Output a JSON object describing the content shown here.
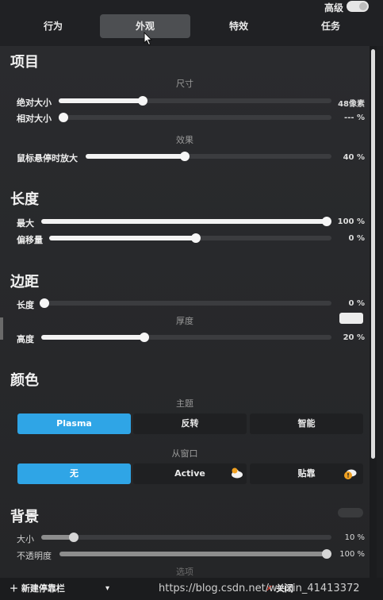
{
  "header": {
    "tabs": [
      "行为",
      "外观",
      "特效",
      "任务"
    ],
    "active_tab": "外观",
    "advanced_label": "高级"
  },
  "sections": {
    "items": {
      "title": "项目",
      "size_header": "尺寸",
      "abs_size_label": "绝对大小",
      "abs_size_value": "48像素",
      "abs_size_level": 0.3,
      "rel_size_label": "相对大小",
      "rel_size_value": "--- %",
      "rel_size_level": 0.0,
      "effect_header": "效果",
      "hover_zoom_label": "鼠标悬停时放大",
      "hover_zoom_value": "40 %",
      "hover_zoom_level": 0.4
    },
    "length": {
      "title": "长度",
      "max_label": "最大",
      "max_value": "100 %",
      "max_level": 1.0,
      "offset_label": "偏移量",
      "offset_value": "0 %",
      "offset_level": 0.52
    },
    "margin": {
      "title": "边距",
      "length_label": "长度",
      "length_value": "0 %",
      "length_level": 0.0,
      "thickness_header": "厚度",
      "height_label": "高度",
      "height_value": "20 %",
      "height_level": 0.35
    },
    "colors": {
      "title": "颜色",
      "theme_header": "主题",
      "theme_options": [
        "Plasma",
        "反转",
        "智能"
      ],
      "theme_selected": "Plasma",
      "window_header": "从窗口",
      "window_options": [
        "无",
        "Active",
        "贴靠"
      ],
      "window_selected": "无"
    },
    "background": {
      "title": "背景",
      "size_label": "大小",
      "size_value": "10 %",
      "size_level": 0.1,
      "opacity_label": "不透明度",
      "opacity_value": "100 %",
      "opacity_level": 1.0,
      "options_header_partial": "选项"
    }
  },
  "footer": {
    "new_dock_label": "新建停靠栏",
    "close_label": "关闭",
    "watermark": "https://blog.csdn.net/weixin_41413372"
  },
  "colors": {
    "accent": "#2fa5e6",
    "warning": "#f0a020"
  }
}
